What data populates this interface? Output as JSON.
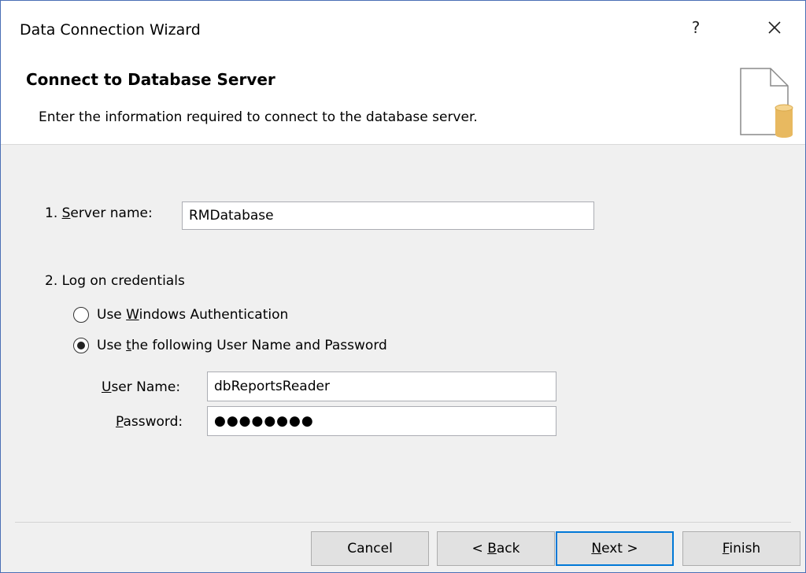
{
  "window": {
    "title": "Data Connection Wizard",
    "help_label": "?",
    "close_icon": "close-icon"
  },
  "header": {
    "title": "Connect to Database Server",
    "subtitle": "Enter the information required to connect to the database server.",
    "icon": "database-document-icon"
  },
  "server": {
    "label_prefix": "1. ",
    "label_accel": "S",
    "label_rest": "erver name:",
    "value": "RMDatabase"
  },
  "credentials": {
    "heading": "2. Log on credentials",
    "option_windows": {
      "pre": "Use ",
      "accel": "W",
      "post": "indows Authentication",
      "selected": false
    },
    "option_userpass": {
      "pre": "Use ",
      "accel": "t",
      "post": "he following User Name and Password",
      "selected": true
    },
    "username": {
      "label_accel": "U",
      "label_rest": "ser Name:",
      "value": "dbReportsReader"
    },
    "password": {
      "label_accel": "P",
      "label_rest": "assword:",
      "value": "●●●●●●●●"
    }
  },
  "buttons": {
    "cancel": "Cancel",
    "back_pre": "< ",
    "back_accel": "B",
    "back_post": "ack",
    "next_accel": "N",
    "next_post": "ext >",
    "finish_accel": "F",
    "finish_post": "inish"
  },
  "colors": {
    "accent": "#0078d7",
    "cylinder": "#e8b960"
  }
}
